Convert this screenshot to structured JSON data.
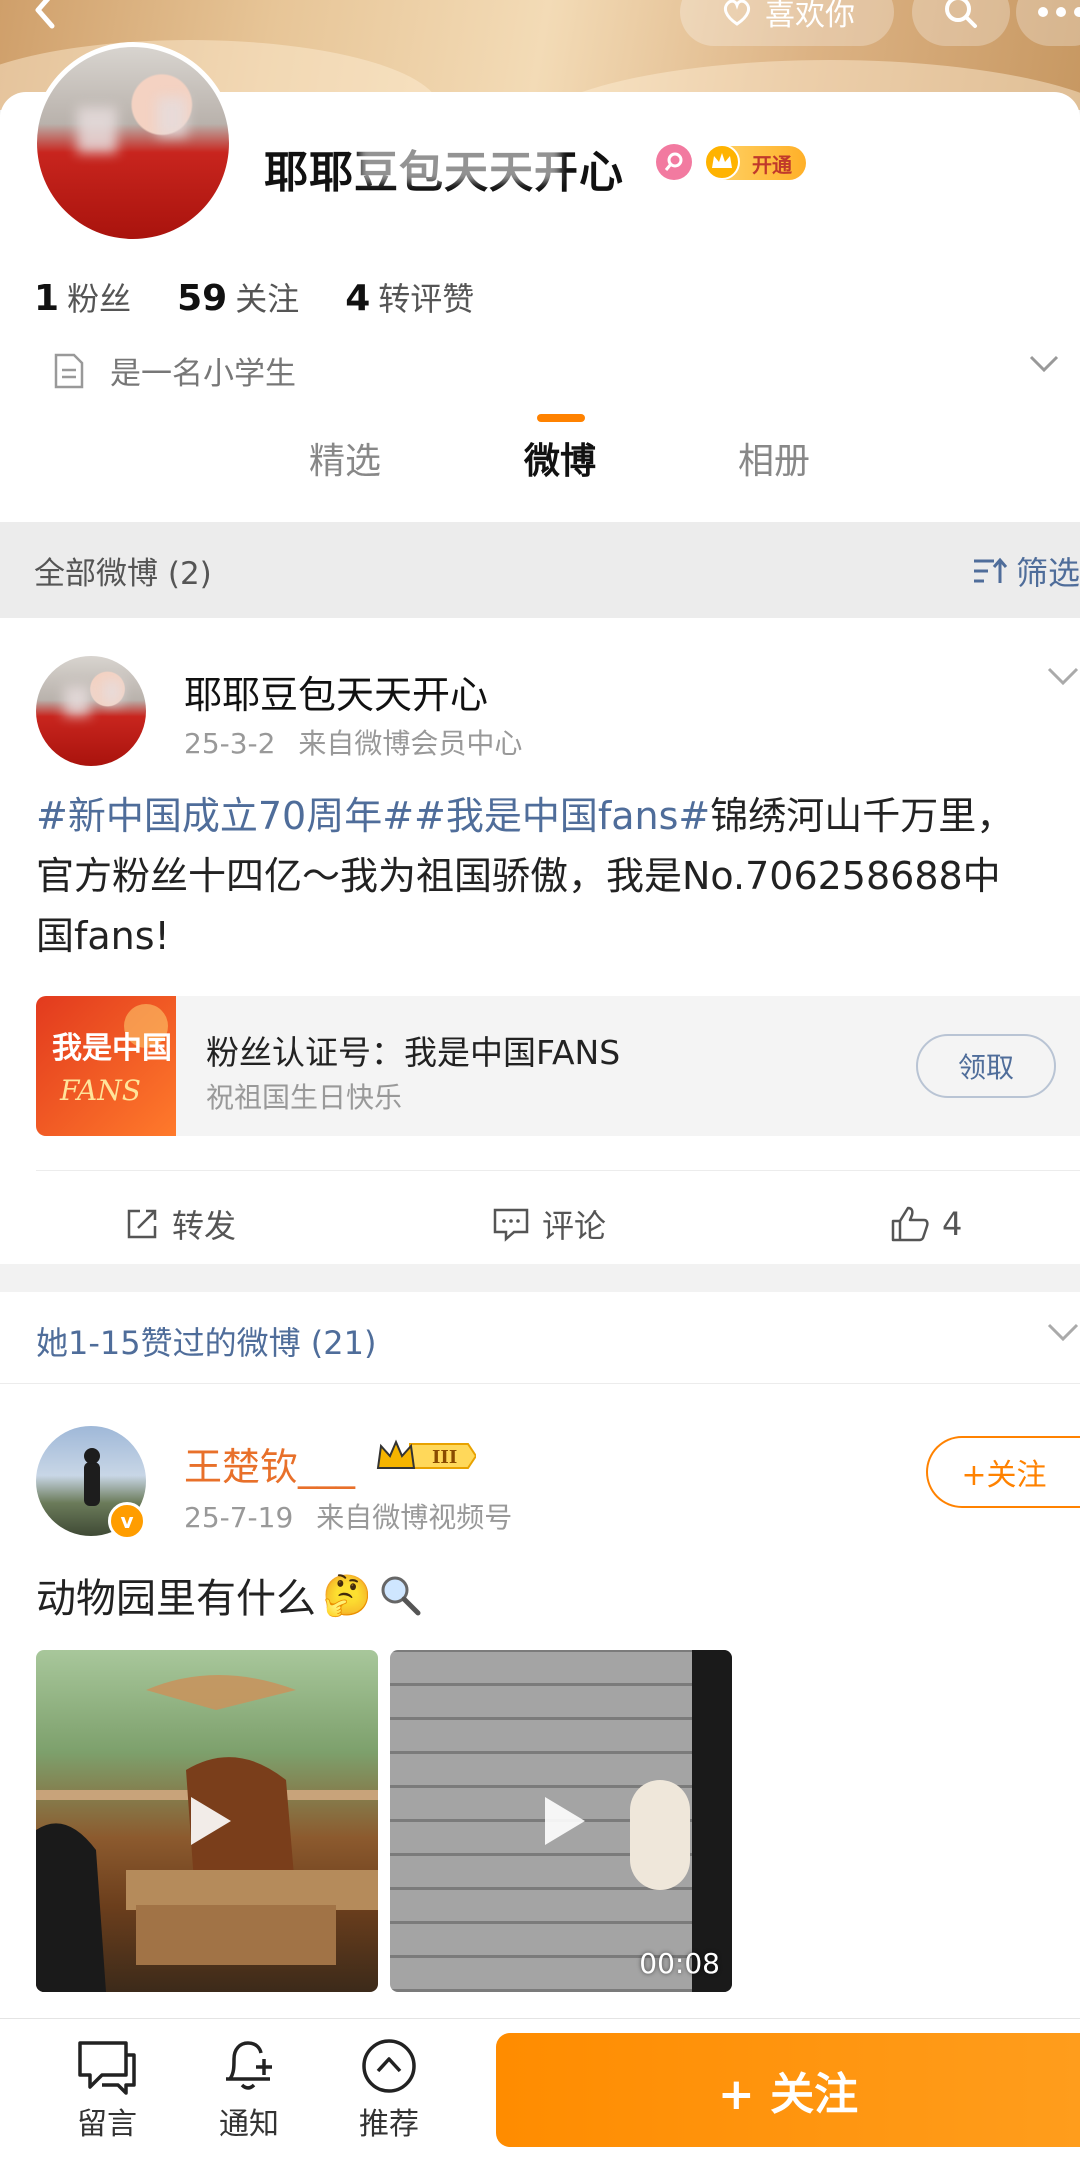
{
  "header": {
    "like_label": "喜欢你"
  },
  "profile": {
    "name": "耶耶豆包天天开心",
    "vip_label": "开通",
    "stats": [
      {
        "value": "1",
        "label": "粉丝"
      },
      {
        "value": "59",
        "label": "关注"
      },
      {
        "value": "4",
        "label": "转评赞"
      }
    ],
    "bio": "是一名小学生",
    "tabs": [
      "精选",
      "微博",
      "相册"
    ],
    "active_tab": "微博"
  },
  "filter": {
    "left": "全部微博 (2)",
    "right": "筛选"
  },
  "post1": {
    "author": "耶耶豆包天天开心",
    "date": "25-3-2",
    "source": "来自微博会员中心",
    "topic1": "#新中国成立70周年#",
    "topic2": "#我是中国fans#",
    "text": "锦绣河山千万里，官方粉丝十四亿～我为祖国骄傲，我是No.706258688中国fans!",
    "card": {
      "thumb_text": "我是中国FANS",
      "title": "粉丝认证号：我是中国FANS",
      "subtitle": "祝祖国生日快乐",
      "button": "领取"
    },
    "actions": {
      "repost": "转发",
      "comment": "评论",
      "like_count": "4"
    }
  },
  "liked_section": {
    "label": "她1-15赞过的微博 (21)"
  },
  "post2": {
    "author": "王楚钦___",
    "rank": "III",
    "verified_mark": "v",
    "date": "25-7-19",
    "source": "来自微博视频号",
    "text": "动物园里有什么",
    "emoji": "🤔",
    "follow": "+关注",
    "video2_duration": "00:08"
  },
  "bottom_bar": {
    "items": [
      "留言",
      "通知",
      "推荐"
    ],
    "follow_button": "+ 关注"
  },
  "colors": {
    "accent_orange": "#ff8200",
    "link_blue": "#4f6d9a",
    "username_orange": "#e8702a"
  }
}
